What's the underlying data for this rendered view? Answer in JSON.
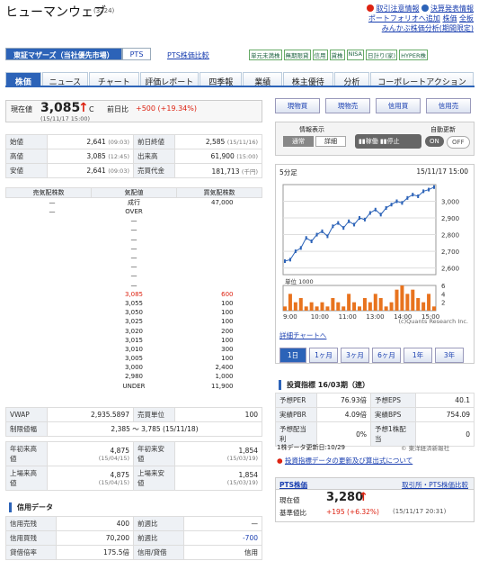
{
  "header": {
    "title": "ヒューマンウェブ",
    "code": "(3224)",
    "links": [
      "取引注意情報",
      "決算発表情報",
      "ポートフォリオへ追加",
      "株価",
      "全板",
      "みんかぶ株価分析(期間限定)"
    ]
  },
  "market": {
    "selected": "東証マザーズ（当社優先市場）",
    "pts": "PTS",
    "compare": "PTS株価比較",
    "tags": [
      "単元未満株",
      "無期限貸",
      "信用",
      "貸株",
      "NISA",
      "日計り(家)",
      "HYPER株"
    ]
  },
  "tabs": [
    "株価",
    "ニュース",
    "チャート",
    "評価レポート",
    "四季報",
    "業績",
    "株主優待",
    "分析",
    "コーポレートアクション"
  ],
  "price": {
    "label": "現在値",
    "value": "3,085",
    "mark": "↑",
    "c": "C",
    "time": "(15/11/17 15:00)",
    "chg_label": "前日比",
    "chg": "+500 (+19.34%)"
  },
  "quote_rows": [
    {
      "l1": "始値",
      "v1": "2,641",
      "t1": "(09:03)",
      "l2": "前日終値",
      "v2": "2,585",
      "t2": "(15/11/16)"
    },
    {
      "l1": "高値",
      "v1": "3,085",
      "t1": "(12:45)",
      "l2": "出来高",
      "v2": "61,900",
      "t2": "(15:00)"
    },
    {
      "l1": "安値",
      "v1": "2,641",
      "t1": "(09:03)",
      "l2": "売買代金",
      "v2": "181,713",
      "t2": "(千円)"
    }
  ],
  "board": {
    "headers": [
      "売気配株数",
      "気配値",
      "買気配株数"
    ],
    "rows": [
      {
        "s": "—",
        "p": "成行",
        "b": "47,000"
      },
      {
        "s": "—",
        "p": "OVER",
        "b": ""
      },
      {
        "s": "",
        "p": "—",
        "b": ""
      },
      {
        "s": "",
        "p": "—",
        "b": ""
      },
      {
        "s": "",
        "p": "—",
        "b": ""
      },
      {
        "s": "",
        "p": "—",
        "b": ""
      },
      {
        "s": "",
        "p": "—",
        "b": ""
      },
      {
        "s": "",
        "p": "—",
        "b": ""
      },
      {
        "s": "",
        "p": "—",
        "b": ""
      },
      {
        "s": "",
        "p": "—",
        "b": ""
      },
      {
        "s": "",
        "p": "3,085",
        "b": "600",
        "hl": true
      },
      {
        "s": "",
        "p": "3,055",
        "b": "100"
      },
      {
        "s": "",
        "p": "3,050",
        "b": "100"
      },
      {
        "s": "",
        "p": "3,025",
        "b": "100"
      },
      {
        "s": "",
        "p": "3,020",
        "b": "200"
      },
      {
        "s": "",
        "p": "3,015",
        "b": "100"
      },
      {
        "s": "",
        "p": "3,010",
        "b": "300"
      },
      {
        "s": "",
        "p": "3,005",
        "b": "100"
      },
      {
        "s": "",
        "p": "3,000",
        "b": "2,400"
      },
      {
        "s": "",
        "p": "2,980",
        "b": "1,000"
      },
      {
        "s": "",
        "p": "UNDER",
        "b": "11,900"
      }
    ]
  },
  "stats": {
    "vwap": {
      "l": "VWAP",
      "v": "2,935.5897",
      "l2": "売買単位",
      "v2": "100"
    },
    "limit": {
      "l": "制限値幅",
      "v": "2,385 〜 3,785 (15/11/18)"
    },
    "ytd": {
      "l1": "年初来高値",
      "v1": "4,875",
      "d1": "(15/04/15)",
      "l2": "年初来安値",
      "v2": "1,854",
      "d2": "(15/03/19)"
    },
    "listed": {
      "l1": "上場来高値",
      "v1": "4,875",
      "d1": "(15/04/15)",
      "l2": "上場来安値",
      "v2": "1,854",
      "d2": "(15/03/19)"
    }
  },
  "margin": {
    "title": "信用データ",
    "rows": [
      {
        "l1": "信用売残",
        "v1": "400",
        "l2": "前週比",
        "v2": "—"
      },
      {
        "l1": "信用買残",
        "v1": "70,200",
        "l2": "前週比",
        "v2": "-700"
      },
      {
        "l1": "貸借倍率",
        "v1": "175.5倍",
        "l2": "信用/貸借",
        "v2": "信用"
      }
    ]
  },
  "right": {
    "buttons": [
      "現物買",
      "現物売",
      "信用買",
      "信用売"
    ],
    "display": {
      "label": "情報表示",
      "normal": "通常",
      "detail": "詳細",
      "auto": "自動更新",
      "t1": "稼働",
      "t2": "停止",
      "on": "ON",
      "off": "OFF"
    },
    "chart_label": "5分足",
    "chart_time": "15/11/17 15:00",
    "detail_link": "詳細チャートへ",
    "credit": "(c)Quants Research Inc.",
    "periods": [
      "1日",
      "1ヶ月",
      "3ヶ月",
      "6ヶ月",
      "1年",
      "3年"
    ],
    "metrics_title": "投資指標 16/03期（連）",
    "metrics": [
      {
        "l1": "予想PER",
        "v1": "76.93倍",
        "l2": "予想EPS",
        "v2": "40.1"
      },
      {
        "l1": "実績PBR",
        "v1": "4.09倍",
        "l2": "実績BPS",
        "v2": "754.09"
      },
      {
        "l1": "予想配当利",
        "v1": "0%",
        "l2": "予想1株配当",
        "v2": "0"
      }
    ],
    "update": "1株データ更新日:10/29",
    "source": "© 東洋経済新報社",
    "notice": "投資指標データの更新及び算出式について",
    "pts": {
      "title": "PTS株価",
      "link": "取引所・PTS株価比較",
      "label": "現在値",
      "value": "3,280",
      "mark": "↑",
      "sub_label": "基準値比",
      "chg": "+195 (+6.32%)",
      "time": "(15/11/17 20:31)"
    }
  },
  "chart_data": {
    "type": "line",
    "title": "5分足",
    "x_ticks": [
      "9:00",
      "10:00",
      "11:00",
      "13:00",
      "14:00",
      "15:00"
    ],
    "y_ticks": [
      2600,
      2700,
      2800,
      2900,
      3000
    ],
    "ylim": [
      2560,
      3100
    ],
    "price": [
      2641,
      2650,
      2700,
      2720,
      2780,
      2760,
      2800,
      2820,
      2790,
      2850,
      2870,
      2840,
      2880,
      2860,
      2900,
      2890,
      2930,
      2950,
      2920,
      2960,
      2980,
      3000,
      2990,
      3020,
      3040,
      3030,
      3060,
      3070,
      3085
    ],
    "volume_label": "単位 1000",
    "volume_ticks": [
      2,
      4,
      6
    ],
    "volume": [
      1,
      4,
      2,
      3,
      1,
      2,
      1,
      2,
      1,
      3,
      2,
      1,
      4,
      2,
      1,
      3,
      2,
      4,
      3,
      1,
      2,
      5,
      6,
      4,
      5,
      3,
      2,
      4,
      1
    ]
  }
}
